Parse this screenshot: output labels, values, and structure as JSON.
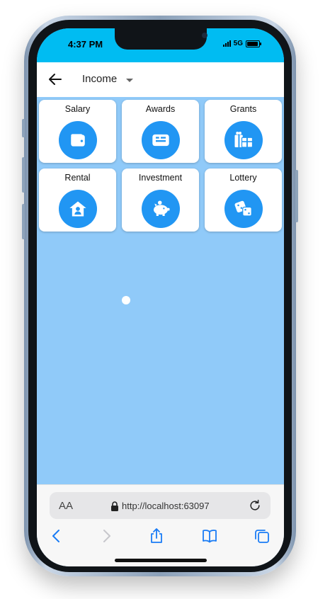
{
  "status_bar": {
    "time": "4:37 PM",
    "network": "5G"
  },
  "app_bar": {
    "title": "Income"
  },
  "categories": [
    {
      "label": "Salary",
      "icon": "wallet-icon"
    },
    {
      "label": "Awards",
      "icon": "id-card-icon"
    },
    {
      "label": "Grants",
      "icon": "gifts-icon"
    },
    {
      "label": "Rental",
      "icon": "house-user-icon"
    },
    {
      "label": "Investment",
      "icon": "piggy-bank-icon"
    },
    {
      "label": "Lottery",
      "icon": "dice-icon"
    }
  ],
  "browser": {
    "text_size_label": "AA",
    "url": "http://localhost:63097"
  },
  "colors": {
    "status_bar": "#00bcf2",
    "body_bg": "#90caf9",
    "accent": "#2196f3",
    "browser_blue": "#1a7cf5"
  }
}
